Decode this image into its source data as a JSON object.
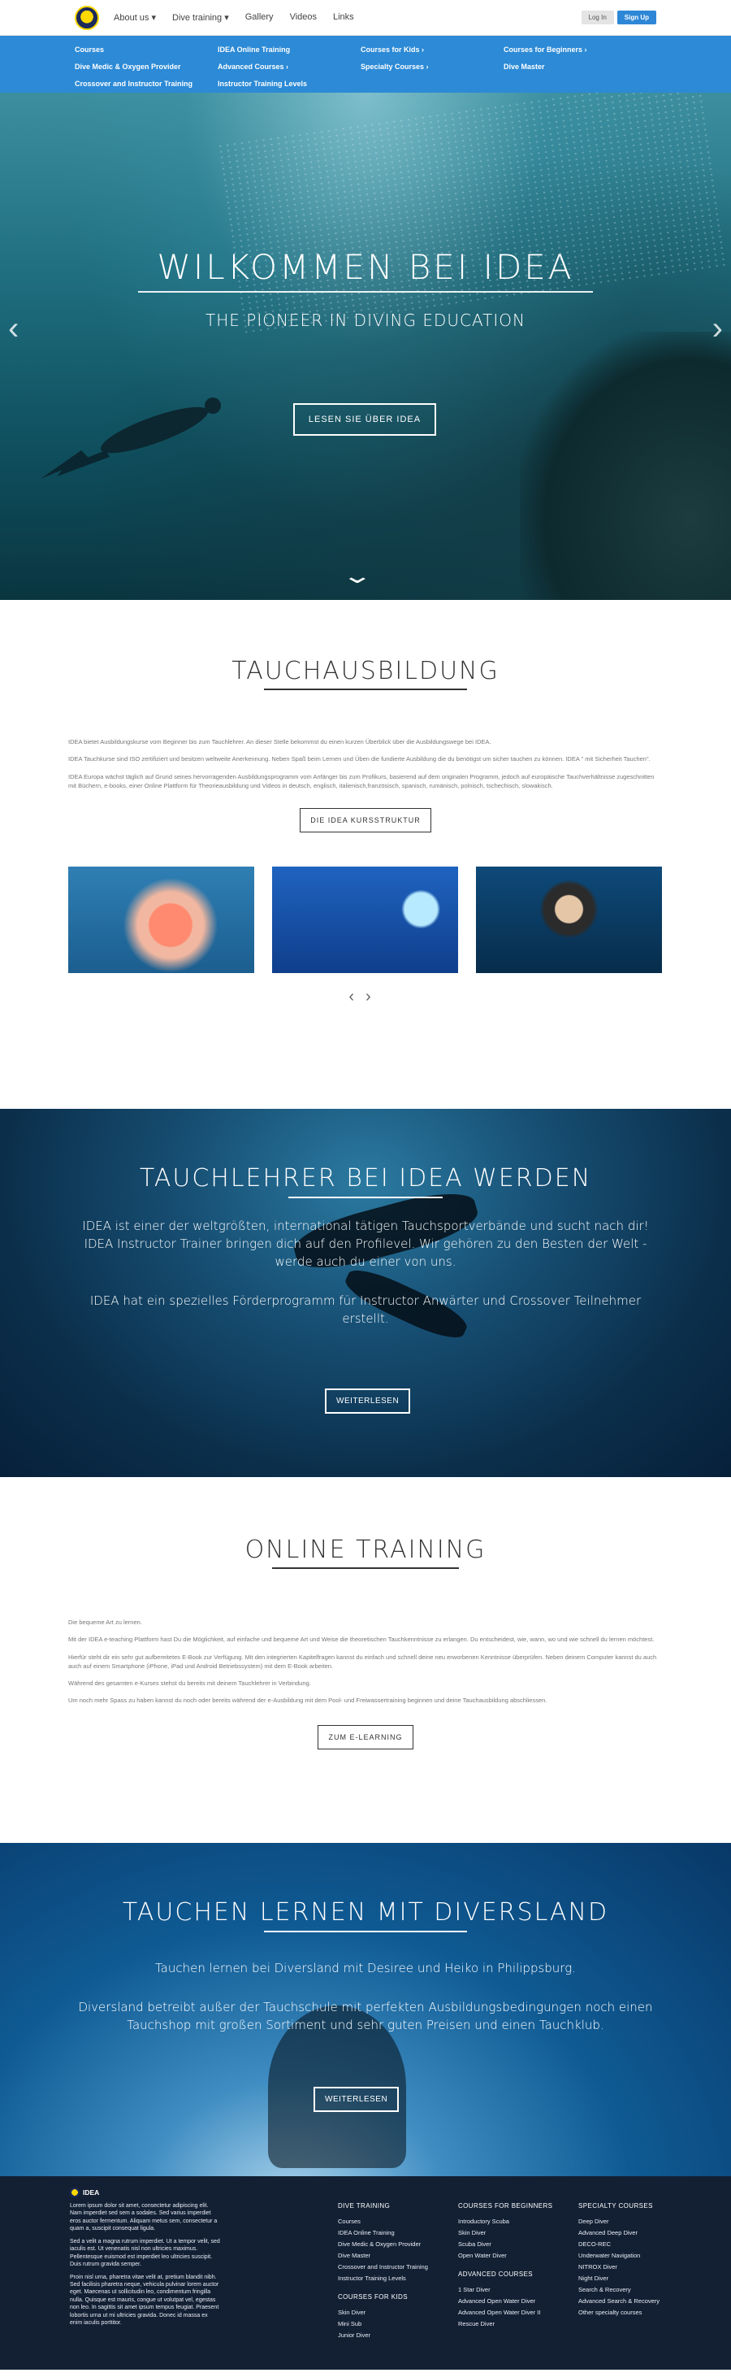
{
  "nav": {
    "links": [
      "About us ▾",
      "Dive training ▾",
      "Gallery",
      "Videos",
      "Links"
    ],
    "login": "Log In",
    "signup": "Sign Up"
  },
  "megamenu": [
    "Courses",
    "IDEA Online Training",
    "Courses for Kids ›",
    "Courses for Beginners ›",
    "Dive Medic & Oxygen Provider",
    "Advanced Courses ›",
    "Specialty Courses ›",
    "Dive Master",
    "Crossover and Instructor Training",
    "Instructor Training Levels",
    "",
    ""
  ],
  "hero": {
    "title": "WILKOMMEN BEI IDEA",
    "subtitle": "THE PIONEER IN DIVING EDUCATION",
    "button": "LESEN SIE ÜBER IDEA"
  },
  "tauch": {
    "title": "TAUCHAUSBILDUNG",
    "texts": [
      "IDEA bietet Ausbildungskurse vom Beginner bis zum Tauchlehrer. An dieser Stelle bekommst du einen kurzen Überblick über die Ausbildungswege bei IDEA.",
      "IDEA Tauchkurse sind ISO zertifiziert und besitzen weltweite Anerkennung. Neben Spaß beim Lernen und Üben die fundierte Ausbildung die du benötigst um sicher tauchen zu können. IDEA \" mit Sicherheit Tauchen\".",
      "IDEA Europa wächst täglich auf Grund seines hervorragenden Ausbildungsprogramm vom Anfänger bis zum Profikurs, basierend auf dem originalen Programm, jedoch auf europäische Tauchverhältnisse zugeschnitten mit Büchern, e-books, einer Online Plattform für Theorieausbildung und Videos in deutsch, englisch, italienisch,französisch, spanisch, rumänisch, polnisch, tschechisch, slowakisch."
    ],
    "button": "DIE IDEA KURSSTRUKTUR"
  },
  "tauchlehrer": {
    "title": "TAUCHLEHRER BEI IDEA WERDEN",
    "p1": "IDEA ist einer der weltgrößten, international tätigen Tauchsportverbände und sucht nach dir! IDEA Instructor Trainer bringen dich auf den Profilevel. Wir gehören zu den Besten der Welt - werde auch du einer von uns.",
    "p2": "IDEA hat ein spezielles Förderprogramm für Instructor Anwärter und Crossover Teilnehmer erstellt.",
    "button": "WEITERLESEN"
  },
  "online": {
    "title": "ONLINE TRAINING",
    "texts": [
      "Die bequeme Art zu lernen.",
      "Mit der IDEA e-teaching Plattform hast Du die Möglichkeit, auf einfache und bequeme Art und Weise die theoretischen Tauchkenntnisse zu erlangen. Du entscheidest, wie, wann, wo und wie schnell du lernen möchtest.",
      "Hierfür steht dir ein sehr gut aufbereitetes E-Book zur Verfügung. Mit den integrierten Kapitelfragen kannst du einfach und schnell deine neu erworbenen Kenntnisse überprüfen. Neben deinem Computer kannst du auch auch auf einem Smartphone (iPhone, iPad und Android Betriebssystem) mit dem E-Book arbeiten.",
      "Während des gesamten e-Kurses stehst du bereits mit deinem Tauchlehrer in Verbindung.",
      "Um noch mehr Spass zu haben kannst du noch oder bereits während der e-Ausbildung mit dem Pool- und Freiwassertraining beginnen und deine Tauchausbildung abschliessen."
    ],
    "button": "ZUM E-LEARNING"
  },
  "diversland": {
    "title": "TAUCHEN LERNEN MIT DIVERSLAND",
    "p1": "Tauchen lernen bei Diversland  mit Desiree und Heiko in Philippsburg.",
    "p2": "Diversland betreibt außer der Tauchschule mit perfekten Ausbildungsbedingungen noch einen Tauchshop mit großen Sortiment und sehr guten Preisen und einen Tauchklub.",
    "button": "WEITERLESEN"
  },
  "footer": {
    "brand": "IDEA",
    "lorem": [
      "Lorem ipsum dolor sit amet, consectetur adipiscing elit. Nam imperdiet sed sem a sodales. Sed varius imperdiet eros auctor fermentum. Aliquam metus sem, consectetur a quam a, suscipit consequat ligula.",
      "Sed a velit a magna rutrum imperdiet. Ut a tempor velit, sed iaculis est. Ut venenatis nisl non ultricies maximus. Pellentesque euismod est imperdiet leo ultricies suscipit. Duis rutrum gravida semper.",
      "Proin nisl urna, pharetra vitae velit at, pretium blandit nibh. Sed facilisis pharetra neque, vehicula pulvinar lorem auctor eget. Maecenas ut sollicitudin leo, condimentum fringilla nulla. Quisque est mauris, congue ut volutpat vel, egestas non leo. In sagittis sit amet ipsum tempus feugiat. Praesent lobortis urna ut mi ultricies gravida. Donec id massa ex enim iaculis porttitor."
    ],
    "col1": {
      "h1": "DIVE TRAINING",
      "items1": [
        "Courses",
        "IDEA Online Training",
        "Dive Medic & Oxygen Provider",
        "Dive Master",
        "Crossover and Instructor Training",
        "Instructor Training Levels"
      ],
      "h2": "COURSES FOR KIDS",
      "items2": [
        "Skin Diver",
        "Mini Sub",
        "Junior Diver"
      ]
    },
    "col2": {
      "h1": "COURSES FOR BEGINNERS",
      "items1": [
        "Introductory Scuba",
        "Skin Diver",
        "Scuba Diver",
        "Open Water Diver"
      ],
      "h2": "ADVANCED COURSES",
      "items2": [
        "1 Star Diver",
        "Advanced Open Water Diver",
        "Advanced Open Water Diver II",
        "Rescue Diver"
      ]
    },
    "col3": {
      "h1": "SPECIALTY COURSES",
      "items1": [
        "Deep Diver",
        "Advanced Deep Diver",
        "DECO-REC",
        "Underwater Navigation",
        "NITROX Diver",
        "Night Diver",
        "Search & Recovery",
        "Advanced Search & Recovery",
        "Other specialty courses"
      ]
    }
  }
}
